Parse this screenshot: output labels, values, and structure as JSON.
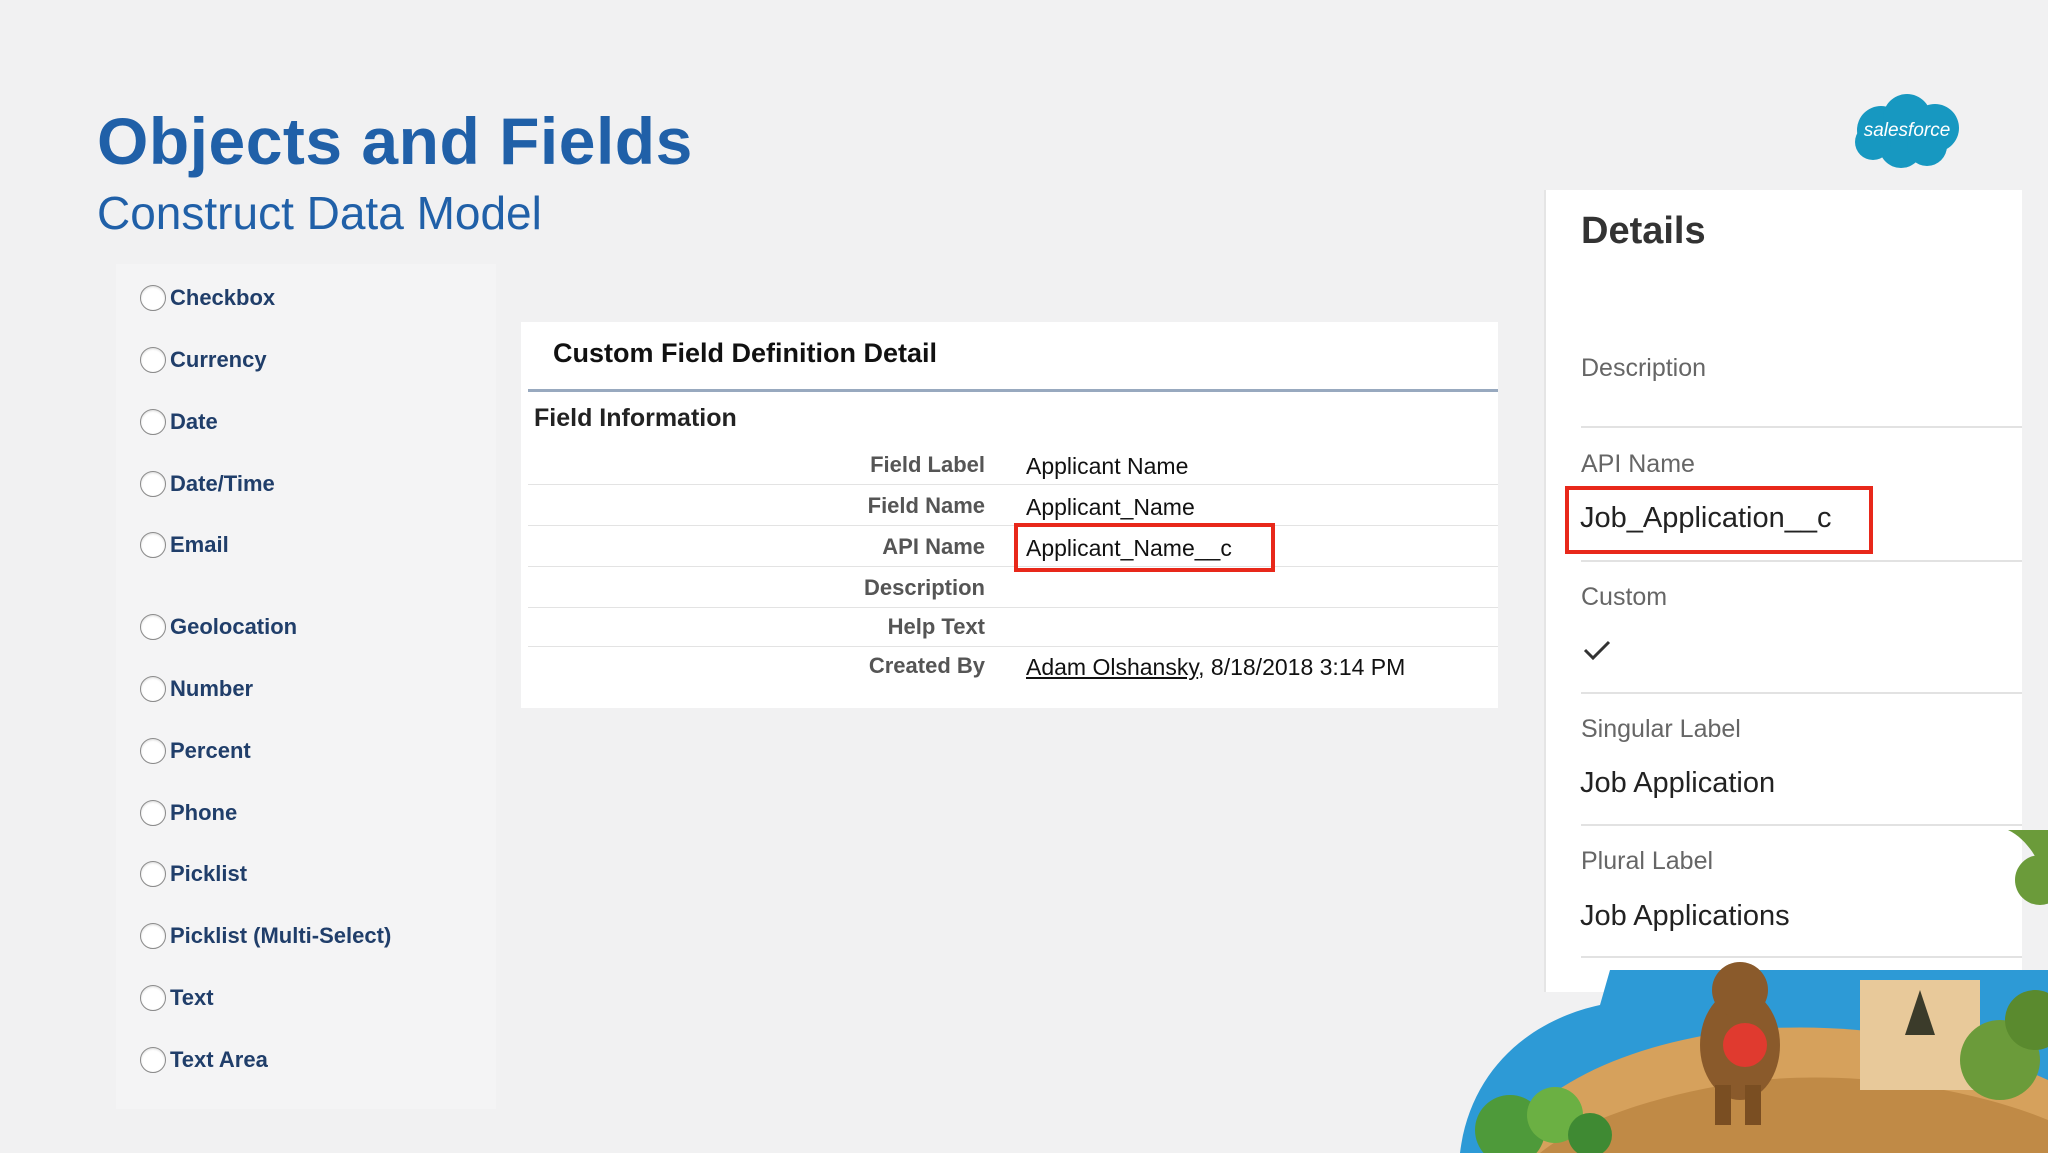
{
  "slide": {
    "title": "Objects and Fields",
    "subtitle": "Construct Data Model"
  },
  "logo": {
    "text": "salesforce",
    "color": "#1798c1"
  },
  "field_types": [
    "Checkbox",
    "Currency",
    "Date",
    "Date/Time",
    "Email",
    "Geolocation",
    "Number",
    "Percent",
    "Phone",
    "Picklist",
    "Picklist (Multi-Select)",
    "Text",
    "Text Area"
  ],
  "definition": {
    "header": "Custom Field Definition Detail",
    "section": "Field Information",
    "rows": [
      {
        "label": "Field Label",
        "value": "Applicant Name"
      },
      {
        "label": "Field Name",
        "value": "Applicant_Name"
      },
      {
        "label": "API Name",
        "value": "Applicant_Name__c"
      },
      {
        "label": "Description",
        "value": ""
      },
      {
        "label": "Help Text",
        "value": ""
      },
      {
        "label": "Created By",
        "value_link": "Adam Olshansky",
        "value": ", 8/18/2018 3:14 PM"
      }
    ]
  },
  "details": {
    "title": "Details",
    "description_label": "Description",
    "api_name_label": "API Name",
    "api_name_value": "Job_Application__c",
    "custom_label": "Custom",
    "custom_checked": true,
    "singular_label": "Singular Label",
    "singular_value": "Job Application",
    "plural_label": "Plural Label",
    "plural_value": "Job Applications"
  },
  "colors": {
    "title_blue": "#2060a8",
    "highlight_red": "#e8281a",
    "background": "#f1f1f2"
  }
}
